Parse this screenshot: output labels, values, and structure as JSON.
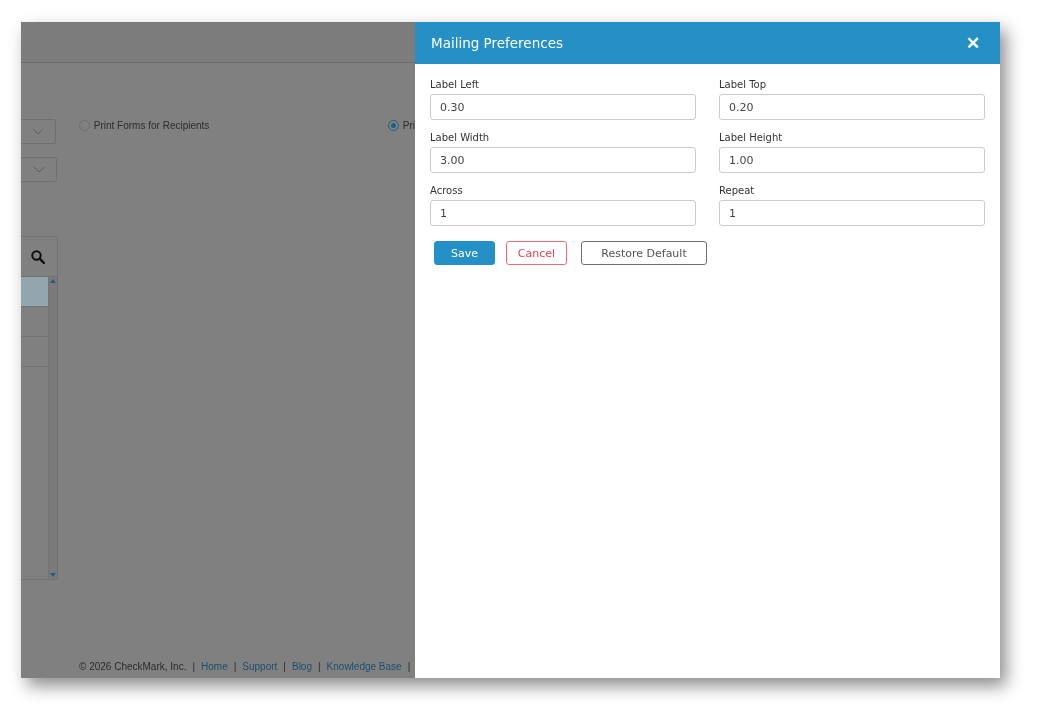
{
  "background": {
    "options": [
      {
        "label": "Print Forms for Recipients",
        "selected": false
      },
      {
        "label": "Pri",
        "selected": true
      }
    ],
    "table": {
      "rows": [
        {
          "selected": true
        },
        {
          "selected": false
        },
        {
          "selected": false
        }
      ]
    },
    "footer": {
      "copyright": "© 2026 CheckMark, Inc.",
      "separator": "|",
      "links": [
        "Home",
        "Support",
        "Blog",
        "Knowledge Base"
      ]
    }
  },
  "dialog": {
    "title": "Mailing Preferences",
    "close": "✕",
    "fields": [
      {
        "label": "Label Left",
        "value": "0.30"
      },
      {
        "label": "Label Top",
        "value": "0.20"
      },
      {
        "label": "Label Width",
        "value": "3.00"
      },
      {
        "label": "Label Height",
        "value": "1.00"
      },
      {
        "label": "Across",
        "value": "1"
      },
      {
        "label": "Repeat",
        "value": "1"
      }
    ],
    "buttons": [
      {
        "label": "Save",
        "kind": "primary"
      },
      {
        "label": "Cancel",
        "kind": "danger"
      },
      {
        "label": "Restore Default",
        "kind": "secondary"
      }
    ]
  }
}
